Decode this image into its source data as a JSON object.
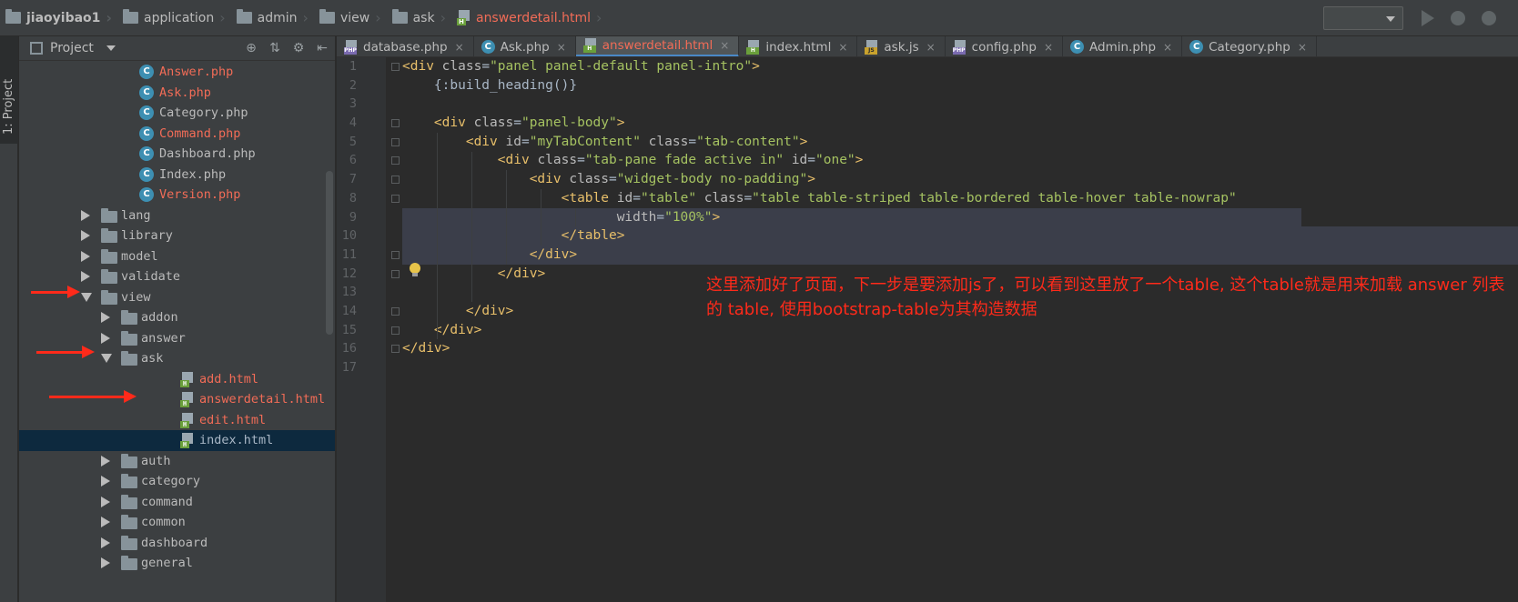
{
  "breadcrumb": {
    "items": [
      "jiaoyibao1",
      "application",
      "admin",
      "view",
      "ask",
      "answerdetail.html"
    ]
  },
  "left_strip": {
    "tab_label": "1: Project"
  },
  "project": {
    "title": "Project",
    "tree": [
      {
        "label": "Answer.php",
        "kind": "class",
        "modified": true
      },
      {
        "label": "Ask.php",
        "kind": "class",
        "modified": true
      },
      {
        "label": "Category.php",
        "kind": "class",
        "modified": false
      },
      {
        "label": "Command.php",
        "kind": "class",
        "modified": true
      },
      {
        "label": "Dashboard.php",
        "kind": "class",
        "modified": false
      },
      {
        "label": "Index.php",
        "kind": "class",
        "modified": false
      },
      {
        "label": "Version.php",
        "kind": "class",
        "modified": true
      },
      {
        "label": "lang",
        "kind": "folder",
        "expanded": false
      },
      {
        "label": "library",
        "kind": "folder",
        "expanded": false
      },
      {
        "label": "model",
        "kind": "folder",
        "expanded": false
      },
      {
        "label": "validate",
        "kind": "folder",
        "expanded": false
      },
      {
        "label": "view",
        "kind": "folder",
        "expanded": true
      },
      {
        "label": "addon",
        "kind": "folder",
        "expanded": false
      },
      {
        "label": "answer",
        "kind": "folder",
        "expanded": false
      },
      {
        "label": "ask",
        "kind": "folder",
        "expanded": true
      },
      {
        "label": "add.html",
        "kind": "html",
        "modified": true
      },
      {
        "label": "answerdetail.html",
        "kind": "html",
        "modified": true
      },
      {
        "label": "edit.html",
        "kind": "html",
        "modified": true
      },
      {
        "label": "index.html",
        "kind": "html",
        "modified": false,
        "selected": true
      },
      {
        "label": "auth",
        "kind": "folder",
        "expanded": false
      },
      {
        "label": "category",
        "kind": "folder",
        "expanded": false
      },
      {
        "label": "command",
        "kind": "folder",
        "expanded": false
      },
      {
        "label": "common",
        "kind": "folder",
        "expanded": false
      },
      {
        "label": "dashboard",
        "kind": "folder",
        "expanded": false
      },
      {
        "label": "general",
        "kind": "folder",
        "expanded": false
      }
    ]
  },
  "tabs": [
    {
      "label": "database.php",
      "icon": "php-file-icon",
      "type": "php",
      "active": false,
      "modified": false
    },
    {
      "label": "Ask.php",
      "icon": "class-file-icon",
      "type": "class",
      "active": false,
      "modified": false
    },
    {
      "label": "answerdetail.html",
      "icon": "html-file-icon",
      "type": "html",
      "active": true,
      "modified": true
    },
    {
      "label": "index.html",
      "icon": "html-file-icon",
      "type": "html",
      "active": false,
      "modified": false
    },
    {
      "label": "ask.js",
      "icon": "js-file-icon",
      "type": "js",
      "active": false,
      "modified": false
    },
    {
      "label": "config.php",
      "icon": "php-file-icon",
      "type": "php",
      "active": false,
      "modified": false
    },
    {
      "label": "Admin.php",
      "icon": "class-file-icon",
      "type": "class",
      "active": false,
      "modified": false
    },
    {
      "label": "Category.php",
      "icon": "class-file-icon",
      "type": "class",
      "active": false,
      "modified": false
    }
  ],
  "code_lines": [
    "<div class=\"panel panel-default panel-intro\">",
    "    {:build_heading()}",
    "",
    "    <div class=\"panel-body\">",
    "        <div id=\"myTabContent\" class=\"tab-content\">",
    "            <div class=\"tab-pane fade active in\" id=\"one\">",
    "                <div class=\"widget-body no-padding\">",
    "                    <table id=\"table\" class=\"table table-striped table-bordered table-hover table-nowrap\"",
    "                           width=\"100%\">",
    "                    </table>",
    "                </div>",
    "            </div>",
    "",
    "        </div>",
    "    </div>",
    "</div>",
    ""
  ],
  "annotation": {
    "text": "这里添加好了页面，下一步是要添加js了，可以看到这里放了一个table, 这个table就是用来加载 answer 列表的 table, 使用bootstrap-table为其构造数据",
    "color": "#ff2a1a"
  },
  "colors": {
    "accent": "#4a88c7",
    "modified_file": "#f26c57",
    "tag": "#e8bf6a",
    "string": "#a5c261"
  }
}
